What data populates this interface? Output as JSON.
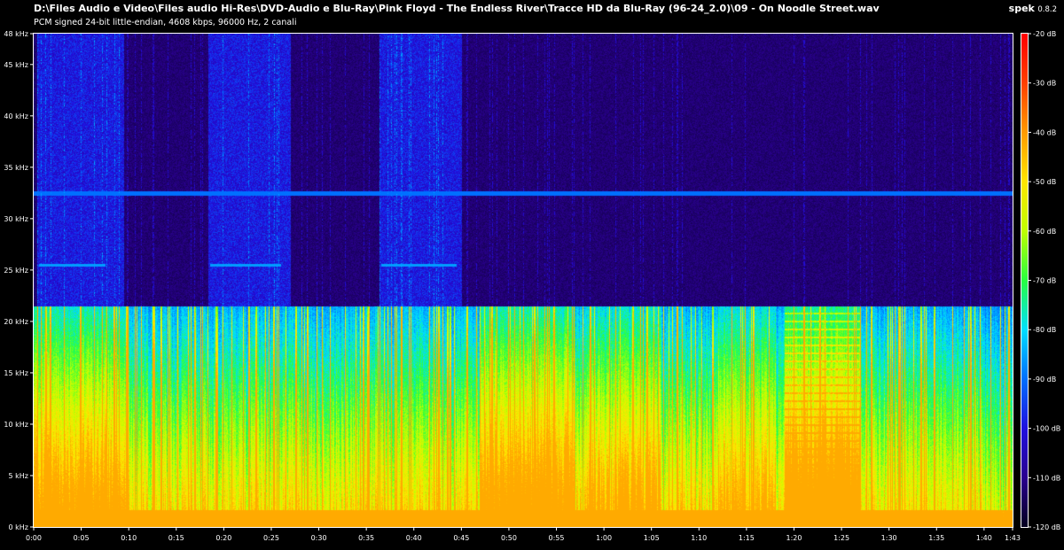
{
  "window": {
    "file_path": "D:\\Files Audio e Video\\Files audio Hi-Res\\DVD-Audio e Blu-Ray\\Pink Floyd - The Endless River\\Tracce HD da Blu-Ray (96-24_2.0)\\09 - On Noodle Street.wav",
    "format_info": "PCM signed 24-bit little-endian, 4608 kbps, 96000 Hz, 2 canali"
  },
  "app": {
    "name": "spek",
    "version": "0.8.2"
  },
  "chart_data": {
    "type": "heatmap",
    "frequency_axis": {
      "unit": "kHz",
      "range": [
        0,
        48
      ],
      "ticks": [
        "0 kHz",
        "5 kHz",
        "10 kHz",
        "15 kHz",
        "20 kHz",
        "25 kHz",
        "30 kHz",
        "35 kHz",
        "40 kHz",
        "45 kHz",
        "48 kHz"
      ]
    },
    "time_axis": {
      "range_seconds": [
        0,
        103
      ],
      "ticks": [
        "0:00",
        "0:05",
        "0:10",
        "0:15",
        "0:20",
        "0:25",
        "0:30",
        "0:35",
        "0:40",
        "0:45",
        "0:50",
        "0:55",
        "1:00",
        "1:05",
        "1:10",
        "1:15",
        "1:20",
        "1:25",
        "1:30",
        "1:35",
        "1:40",
        "1:43"
      ]
    },
    "color_scale": {
      "unit": "dB",
      "range": [
        -120,
        -20
      ],
      "ticks": [
        "-20 dB",
        "-30 dB",
        "-40 dB",
        "-50 dB",
        "-60 dB",
        "-70 dB",
        "-80 dB",
        "-90 dB",
        "-100 dB",
        "-110 dB",
        "-120 dB"
      ],
      "colors": [
        "#ff0000",
        "#ff4000",
        "#ff9b00",
        "#ffe600",
        "#c0ff00",
        "#28ff40",
        "#00e0ff",
        "#0070ff",
        "#2010e0",
        "#2a0090",
        "#050020"
      ]
    },
    "features": {
      "steady_tone_khz": 32.5,
      "content_cutoff_khz": 21.5,
      "intermittent_tone_khz": 25.5,
      "intermittent_tone_segments_sec": [
        [
          0.5,
          7.5
        ],
        [
          18.5,
          26
        ],
        [
          36.5,
          44.5
        ]
      ]
    }
  }
}
